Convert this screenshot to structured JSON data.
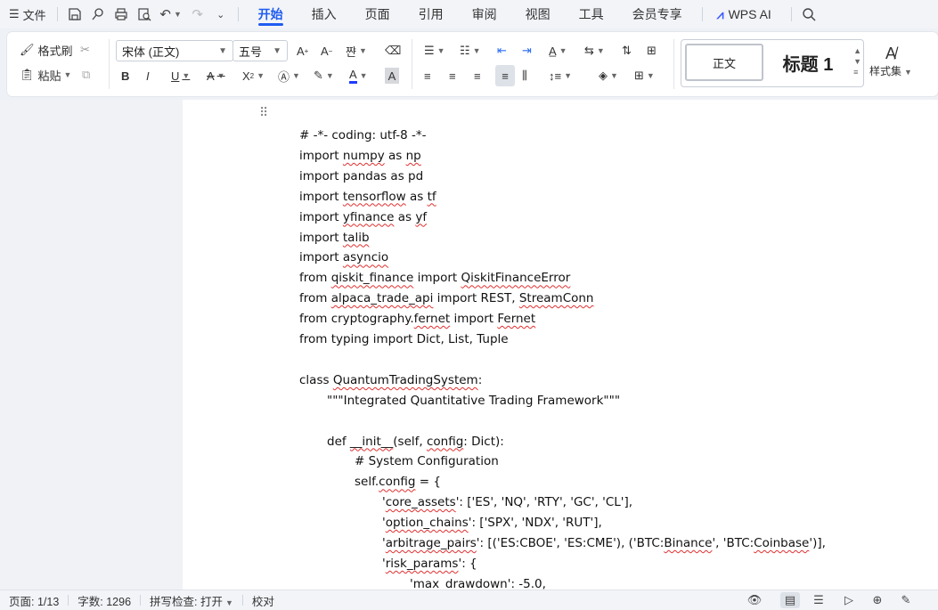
{
  "menubar": {
    "file_label": "文件",
    "tabs": [
      "开始",
      "插入",
      "页面",
      "引用",
      "审阅",
      "视图",
      "工具",
      "会员专享"
    ],
    "wps_ai_label": "WPS AI"
  },
  "ribbon": {
    "format_painter": "格式刷",
    "paste": "粘贴",
    "font_name": "宋体 (正文)",
    "font_size": "五号",
    "style_normal": "正文",
    "style_heading1": "标题 1",
    "style_set": "样式集"
  },
  "document": {
    "lines": [
      "# -*- coding: utf-8 -*-",
      "import numpy as np",
      "import pandas as pd",
      "import tensorflow as tf",
      "import yfinance as yf",
      "import talib",
      "import asyncio",
      "from qiskit_finance import QiskitFinanceError",
      "from alpaca_trade_api import REST, StreamConn",
      "from cryptography.fernet import Fernet",
      "from typing import Dict, List, Tuple",
      "",
      "class QuantumTradingSystem:",
      "\"\"\"Integrated Quantitative Trading Framework\"\"\"",
      "",
      "def __init__(self, config: Dict):",
      "# System Configuration",
      "self.config = {",
      "'core_assets': ['ES', 'NQ', 'RTY', 'GC', 'CL'],",
      "'option_chains': ['SPX', 'NDX', 'RUT'],",
      "'arbitrage_pairs': [('ES:CBOE', 'ES:CME'), ('BTC:Binance', 'BTC:Coinbase')],",
      "'risk_params': {",
      "'max_drawdown': -5.0,"
    ]
  },
  "status": {
    "page": "页面: 1/13",
    "words": "字数: 1296",
    "spell": "拼写检查: 打开",
    "proof": "校对"
  }
}
